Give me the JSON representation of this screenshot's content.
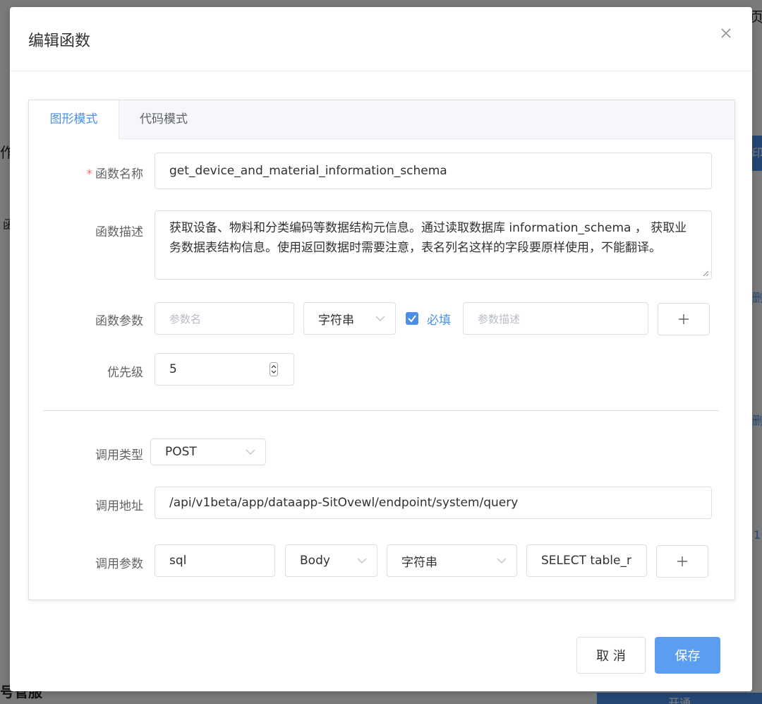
{
  "background": {
    "top_right_char": "页",
    "left_char_1": "作",
    "left_char_2": "函",
    "right_link_1": "删",
    "right_link_2": "删",
    "right_link_3": "1",
    "right_btn": "印",
    "bottom_left": "号管服",
    "bottom_right_btn": "开通"
  },
  "dialog": {
    "title": "编辑函数"
  },
  "tabs": [
    {
      "label": "图形模式",
      "active": true
    },
    {
      "label": "代码模式",
      "active": false
    }
  ],
  "form": {
    "name_label": "函数名称",
    "required_mark": "*",
    "name_value": "get_device_and_material_information_schema",
    "desc_label": "函数描述",
    "desc_value": "获取设备、物料和分类编码等数据结构元信息。通过读取数据库 information_schema ， 获取业务数据表结构信息。使用返回数据时需要注意，表名列名这样的字段要原样使用，不能翻译。",
    "param_label": "函数参数",
    "param_name_placeholder": "参数名",
    "param_type": "字符串",
    "param_required_label": "必填",
    "param_required_checked": true,
    "param_desc_placeholder": "参数描述",
    "priority_label": "优先级",
    "priority_value": "5",
    "call_type_label": "调用类型",
    "call_type_value": "POST",
    "call_url_label": "调用地址",
    "call_url_value": "/api/v1beta/app/dataapp-SitOvewl/endpoint/system/query",
    "call_params_label": "调用参数",
    "call_param_name": "sql",
    "call_param_location": "Body",
    "call_param_type": "字符串",
    "call_param_value": "SELECT table_r"
  },
  "footer": {
    "cancel_label": "取 消",
    "save_label": "保存"
  },
  "colors": {
    "primary": "#4a8fe8",
    "save_button": "#5b9ef1",
    "required": "#f56c6c"
  }
}
